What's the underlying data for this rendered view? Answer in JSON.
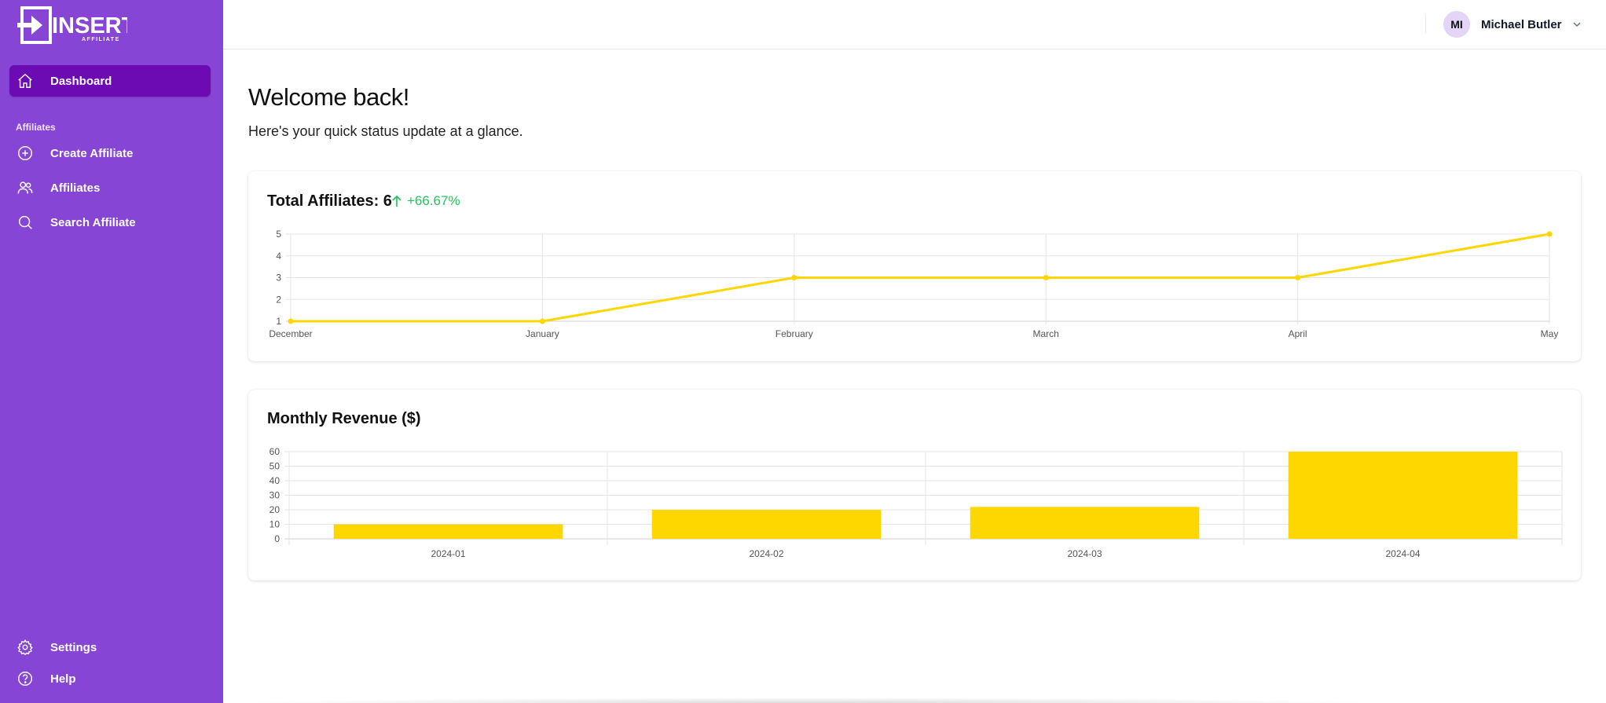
{
  "sidebar": {
    "logo_text": "INSERT",
    "logo_subtext": "AFFILIATE",
    "dashboard_label": "Dashboard",
    "section_label": "Affiliates",
    "create_affiliate_label": "Create Affiliate",
    "affiliates_label": "Affiliates",
    "search_affiliate_label": "Search Affiliate",
    "settings_label": "Settings",
    "help_label": "Help"
  },
  "header": {
    "avatar_initials": "MI",
    "user_name": "Michael Butler"
  },
  "main": {
    "welcome": "Welcome back!",
    "subtitle": "Here's your quick status update at a glance."
  },
  "colors": {
    "sidebar": "#8645d4",
    "active_item": "#6c0ab3",
    "chart": "#ffd700",
    "trend_up": "#22c55e"
  },
  "chart_data": [
    {
      "type": "line",
      "title": "Total Affiliates: 6",
      "trend": "+66.67%",
      "categories": [
        "December",
        "January",
        "February",
        "March",
        "April",
        "May"
      ],
      "values": [
        1,
        1,
        3,
        3,
        3,
        5
      ],
      "y_ticks": [
        "1",
        "2",
        "3",
        "4",
        "5"
      ],
      "ylim": [
        1,
        5
      ],
      "grid": true,
      "legend": "none"
    },
    {
      "type": "bar",
      "title": "Monthly Revenue ($)",
      "categories": [
        "2024-01",
        "2024-02",
        "2024-03",
        "2024-04"
      ],
      "values": [
        10,
        20,
        22,
        60
      ],
      "y_ticks": [
        "0",
        "10",
        "20",
        "30",
        "40",
        "50",
        "60"
      ],
      "ylim": [
        0,
        60
      ],
      "grid": true,
      "legend": "none"
    }
  ]
}
